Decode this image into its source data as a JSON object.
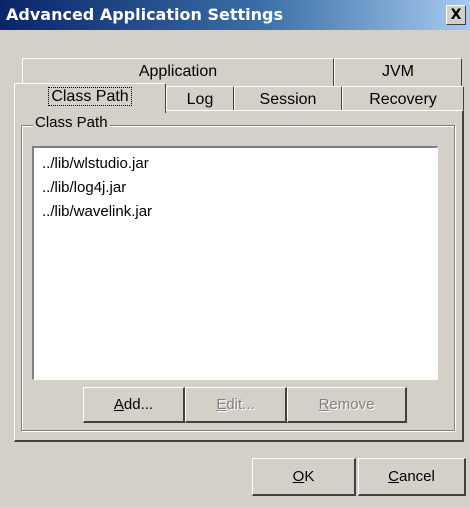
{
  "window": {
    "title": "Advanced Application Settings",
    "close_label": "X"
  },
  "tabs": {
    "row_back": [
      {
        "label": "Application"
      },
      {
        "label": "JVM"
      }
    ],
    "row_front": [
      {
        "label": "Class Path",
        "active": true
      },
      {
        "label": "Log"
      },
      {
        "label": "Session"
      },
      {
        "label": "Recovery"
      }
    ]
  },
  "classpath": {
    "group_label": "Class Path",
    "items": [
      "../lib/wlstudio.jar",
      "../lib/log4j.jar",
      "../lib/wavelink.jar"
    ],
    "buttons": {
      "add": {
        "mnemonic": "A",
        "rest": "dd...",
        "enabled": true
      },
      "edit": {
        "mnemonic": "E",
        "rest": "dit...",
        "enabled": false
      },
      "remove": {
        "mnemonic": "R",
        "rest": "emove",
        "enabled": false
      }
    }
  },
  "footer": {
    "ok": {
      "mnemonic": "O",
      "rest": "K"
    },
    "cancel": {
      "mnemonic": "C",
      "rest": "ancel"
    }
  }
}
